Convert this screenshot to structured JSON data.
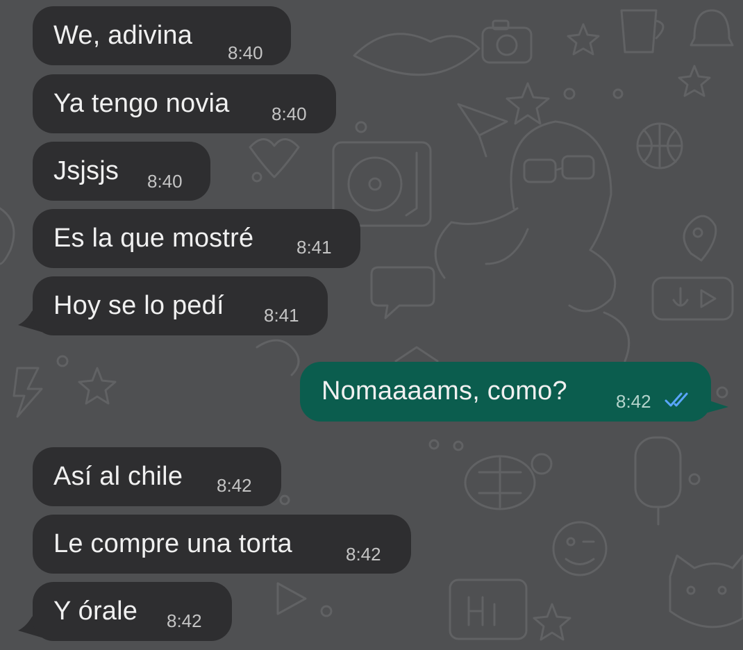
{
  "messages": [
    {
      "direction": "in",
      "text": "We, adivina",
      "time": "8:40"
    },
    {
      "direction": "in",
      "text": "Ya tengo novia",
      "time": "8:40"
    },
    {
      "direction": "in",
      "text": "Jsjsjs",
      "time": "8:40"
    },
    {
      "direction": "in",
      "text": "Es la que mostré",
      "time": "8:41"
    },
    {
      "direction": "in",
      "text": "Hoy se lo pedí",
      "time": "8:41"
    },
    {
      "direction": "out",
      "text": "Nomaaaams, como?",
      "time": "8:42",
      "status_icon": "double-check-icon",
      "status_color": "#5aa6ff"
    },
    {
      "direction": "in",
      "text": "Así al chile",
      "time": "8:42"
    },
    {
      "direction": "in",
      "text": "Le compre una torta",
      "time": "8:42"
    },
    {
      "direction": "in",
      "text": "Y órale",
      "time": "8:42"
    }
  ],
  "colors": {
    "wallpaper": "#4f5052",
    "incoming_bubble": "#2e2e30",
    "outgoing_bubble": "#0b5d4e",
    "read_ticks": "#5aa6ff"
  }
}
